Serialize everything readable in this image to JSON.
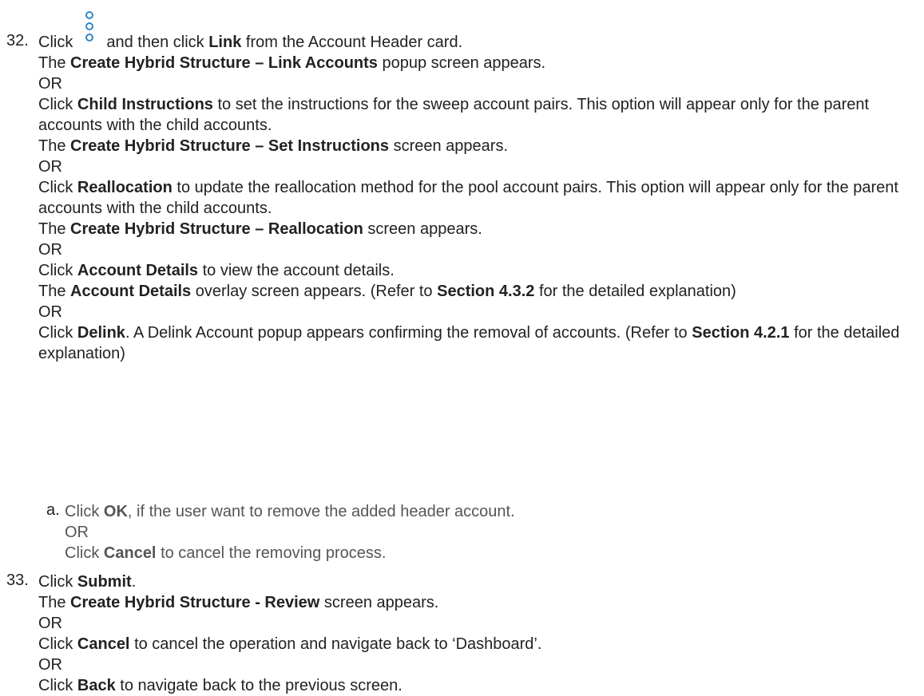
{
  "step32": {
    "number": "32.",
    "click": "Click",
    "after_icon": "and then click",
    "link": "Link",
    "from_card": "from the Account Header card.",
    "icon": "kebab-menu-icon",
    "l2_pre": "The",
    "l2_bold": "Create Hybrid Structure – Link Accounts",
    "l2_post": "popup screen appears.",
    "or": "OR",
    "l4_pre": "Click",
    "l4_bold": "Child Instructions",
    "l4_post": "to set the instructions for the sweep account pairs. This option will appear only for the parent accounts with the child accounts.",
    "l5_pre": "The",
    "l5_bold": "Create Hybrid Structure – Set Instructions",
    "l5_post": "screen appears.",
    "l7_pre": "Click",
    "l7_bold": "Reallocation",
    "l7_post": "to update the reallocation method for the pool account pairs. This option will appear only for the parent accounts with the child accounts.",
    "l8_pre": "The",
    "l8_bold": "Create Hybrid Structure – Reallocation",
    "l8_post": "screen appears.",
    "l10_pre": "Click",
    "l10_bold": "Account Details",
    "l10_post": "to view the account details.",
    "l11_pre": "The",
    "l11_bold": "Account Details",
    "l11_mid": "overlay screen appears. (Refer to",
    "l11_bold2": "Section 4.3.2",
    "l11_post": "for the detailed explanation)",
    "l13_pre": "Click",
    "l13_bold": "Delink",
    "l13_post": ". A Delink Account popup appears confirming the removal of accounts. (Refer to",
    "l13_bold2": "Section 4.2.1",
    "l13_post2": "for the detailed explanation)"
  },
  "sub_a": {
    "letter": "a.",
    "l1_pre": "Click",
    "l1_bold": "OK",
    "l1_post": ", if the user want to remove the added header account.",
    "or": "OR",
    "l3_pre": "Click",
    "l3_bold": "Cancel",
    "l3_post": "to cancel the removing process."
  },
  "step33": {
    "number": "33.",
    "l1_pre": "Click",
    "l1_bold": "Submit",
    "l1_post": ".",
    "l2_pre": "The",
    "l2_bold": "Create Hybrid Structure - Review",
    "l2_post": "screen appears.",
    "or": "OR",
    "l4_pre": "Click",
    "l4_bold": "Cancel",
    "l4_post": "to cancel the operation and navigate back to ‘Dashboard’.",
    "l6_pre": "Click",
    "l6_bold": "Back",
    "l6_post": "to navigate back to the previous screen."
  }
}
